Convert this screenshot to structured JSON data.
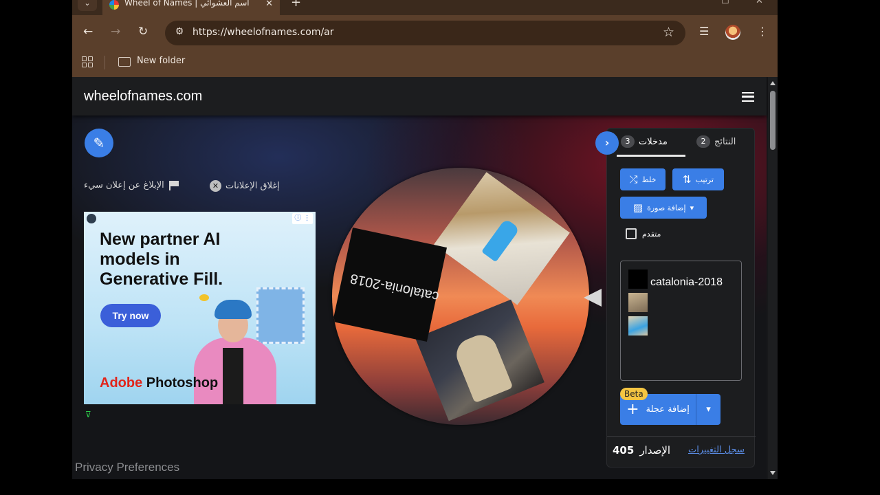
{
  "browser": {
    "tab": {
      "title": "Wheel of Names | اسم العشوائي",
      "favicon": "wheel-favicon-icon",
      "close_glyph": "✕"
    },
    "tab_list_glyph": "⌄",
    "new_tab_glyph": "+",
    "window_controls": {
      "maximize_glyph": "☐",
      "close_glyph": "✕"
    },
    "nav": {
      "back": "←",
      "forward": "→",
      "reload": "↻"
    },
    "address": {
      "url": "https://wheelofnames.com/ar",
      "site_info_glyph": "⚙",
      "star_glyph": "☆"
    },
    "toolbar_icons": {
      "media": "☰",
      "menu": "⋮"
    },
    "bookmarks": {
      "folder_label": "New folder"
    },
    "colors": {
      "frame": "#5a3f2b",
      "omnibox": "#3a2719"
    }
  },
  "site": {
    "logo": "wheelofnames.com",
    "menu_icon": "hamburger-menu-icon",
    "edit_glyph": "✎"
  },
  "ad_controls": {
    "close_ad_label": "إغلاق الإعلانات",
    "close_ad_glyph": "✕",
    "report_ad_label": "الإبلاغ عن إعلان سيء"
  },
  "ad": {
    "headline": "New partner AI models in Generative Fill.",
    "cta": "Try now",
    "brand_adobe": "Adobe",
    "brand_product": " Photoshop",
    "info_glyph": "ⓘ ⋮",
    "bottom_mark": "⊽"
  },
  "wheel": {
    "entries": [
      "catalonia-2018",
      "photo-entry-2",
      "photo-entry-3"
    ],
    "slice_label": "catalonia-2018",
    "pointer": "wheel-pointer-icon"
  },
  "panel": {
    "tabs": {
      "entries_label": "مدخلات",
      "entries_count": "3",
      "results_label": "النتائج",
      "results_count": "2"
    },
    "collapse_glyph": "›",
    "buttons": {
      "shuffle": "خلط",
      "shuffle_glyph": "⤮",
      "sort": "ترتيب",
      "sort_glyph": "⇅",
      "add_image": "إضافة صورة",
      "add_image_glyph": "▨",
      "add_image_caret": "▾"
    },
    "advanced_label": "متقدم",
    "entry_text": "catalonia-2018",
    "add_wheel": {
      "label": "إضافة عجلة",
      "plus": "+",
      "caret": "▾",
      "badge": "Beta"
    },
    "footer": {
      "changelog": "سجل التغييرات",
      "version_label": "الإصدار",
      "version_number": "405"
    }
  },
  "privacy_prefs": "Privacy Preferences",
  "accent_color": "#3a7ee6"
}
